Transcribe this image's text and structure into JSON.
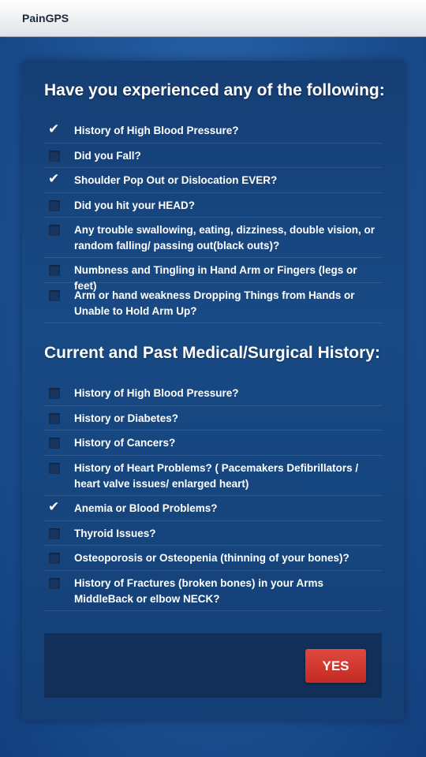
{
  "app": {
    "title": "PainGPS"
  },
  "section1": {
    "title": "Have you experienced any of the following:",
    "items": [
      {
        "label": "History of High Blood Pressure?",
        "checked": true
      },
      {
        "label": "Did you Fall?",
        "checked": false
      },
      {
        "label": "Shoulder Pop Out or Dislocation EVER?",
        "checked": true
      },
      {
        "label": "Did you hit your HEAD?",
        "checked": false
      },
      {
        "label": "Any trouble swallowing, eating, dizziness, double vision, or random falling/ passing out(black outs)?",
        "checked": false
      },
      {
        "label": "Numbness and Tingling in Hand Arm or Fingers (legs or feet)",
        "checked": false
      },
      {
        "label": "Arm or hand weakness Dropping Things from Hands or Unable to Hold Arm Up?",
        "checked": false
      }
    ]
  },
  "section2": {
    "title": "Current and Past Medical/Surgical History:",
    "items": [
      {
        "label": "History of High Blood Pressure?",
        "checked": false
      },
      {
        "label": "History or Diabetes?",
        "checked": false
      },
      {
        "label": "History of Cancers?",
        "checked": false
      },
      {
        "label": "History of Heart Problems? ( Pacemakers Defibrillators / heart valve issues/ enlarged heart)",
        "checked": false
      },
      {
        "label": "Anemia or Blood Problems?",
        "checked": true
      },
      {
        "label": "Thyroid Issues?",
        "checked": false
      },
      {
        "label": "Osteoporosis or Osteopenia (thinning of your bones)?",
        "checked": false
      },
      {
        "label": "History of Fractures (broken bones) in your Arms MiddleBack or elbow NECK?",
        "checked": false
      }
    ]
  },
  "footer": {
    "yes_label": "YES"
  },
  "colors": {
    "accent": "#d8382f",
    "background": "#1f5598",
    "panel": "#184a85"
  }
}
